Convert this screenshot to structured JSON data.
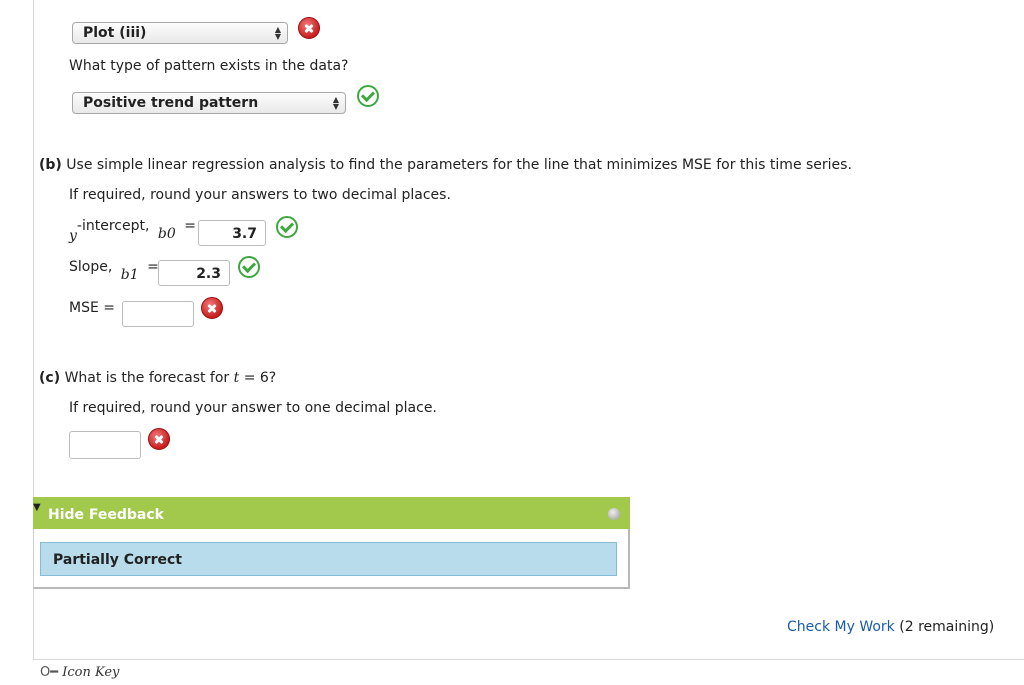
{
  "part_a": {
    "plot_select": "Plot (iii)",
    "pattern_question": "What type of pattern exists in the data?",
    "pattern_select": "Positive trend pattern"
  },
  "part_b": {
    "label": "(b)",
    "question": "Use simple linear regression analysis to find the parameters for the line that minimizes MSE for this time series.",
    "rounding": "If required, round your answers to two decimal places.",
    "intercept_label_y": "y",
    "intercept_label": "-intercept,",
    "intercept_symbol": "b",
    "intercept_sub": "0",
    "intercept_eq": "=",
    "intercept_value": "3.7",
    "slope_label": "Slope,",
    "slope_symbol": "b",
    "slope_sub": "1",
    "slope_eq": "=",
    "slope_value": "2.3",
    "mse_label": "MSE =",
    "mse_value": ""
  },
  "part_c": {
    "label": "(c)",
    "question_pre": "What is the forecast for",
    "question_var": "t",
    "question_post": "= 6?",
    "rounding": "If required, round your answer to one decimal place.",
    "forecast_value": ""
  },
  "feedback": {
    "toggle_label": "Hide Feedback",
    "result": "Partially Correct"
  },
  "footer": {
    "check_link": "Check My Work",
    "remaining": "(2 remaining)",
    "icon_key": "Icon Key"
  },
  "icons": {
    "incorrect": "red-x-icon",
    "correct": "green-check-icon"
  },
  "colors": {
    "correct": "#3ea83e",
    "incorrect": "#c81e1e",
    "feedback_bar": "#a2c94c",
    "feedback_box": "#b8dcec",
    "link": "#1a5da6"
  }
}
